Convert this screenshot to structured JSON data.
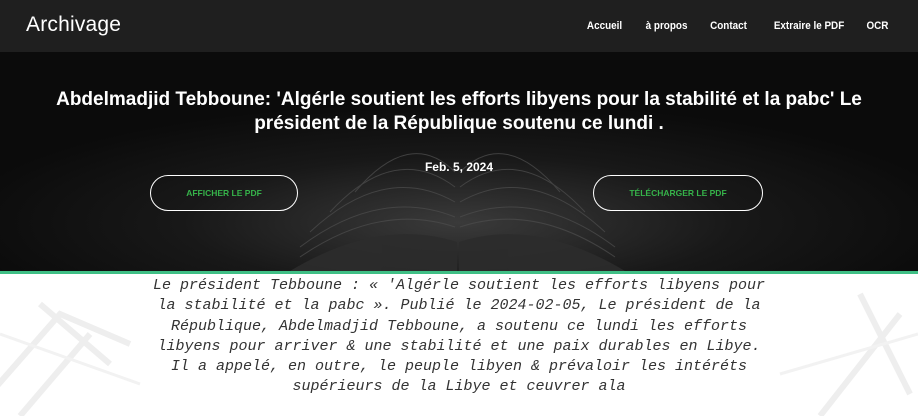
{
  "navbar": {
    "brand": "Archivage",
    "links": [
      "Accueil",
      "à propos",
      "Contact",
      "Extraire le PDF",
      "OCR"
    ]
  },
  "hero": {
    "title": "Abdelmadjid Tebboune: 'Algérle soutient les efforts libyens pour la stabilité et la pabc' Le président de la République soutenu ce lundi .",
    "date": "Feb. 5, 2024",
    "view_label": "AFFICHER LE PDF",
    "download_label": "TÉLÉCHARGER LE PDF"
  },
  "article": {
    "text": "Le président Tebboune : « 'Algérle soutient les efforts libyens pour la stabilité et la pabc ». Publié le 2024-02-05, Le président de la République, Abdelmadjid Tebboune, a soutenu ce lundi les efforts libyens pour arriver & une stabilité et une paix durables en Libye. Il a appelé, en outre, le peuple libyen & prévaloir les intéréts supérieurs de la Libye et ceuvrer ala"
  },
  "colors": {
    "navbar_bg": "#1f1f1f",
    "hero_bg": "#0b0b0b",
    "accent": "#3fbf85",
    "button_text": "#36b34a"
  }
}
